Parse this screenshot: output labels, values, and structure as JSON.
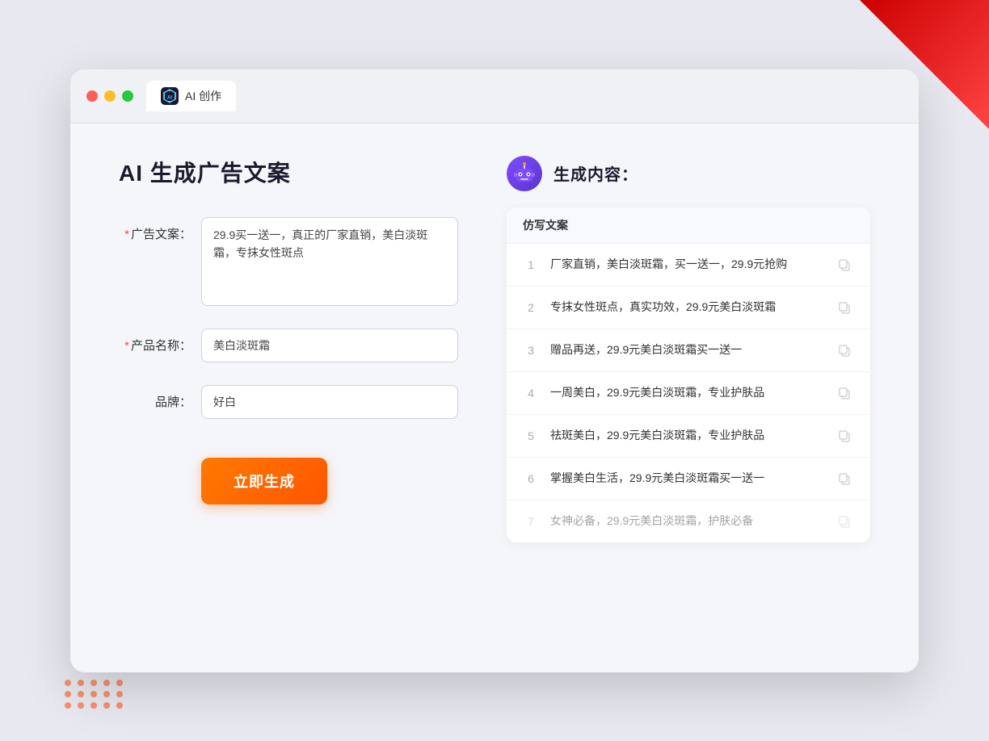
{
  "browser": {
    "tab_label": "AI 创作",
    "traffic_lights": [
      "red",
      "yellow",
      "green"
    ]
  },
  "left_panel": {
    "title": "AI 生成广告文案",
    "form": {
      "ad_copy_label": "广告文案：",
      "ad_copy_required": true,
      "ad_copy_value": "29.9买一送一，真正的厂家直销，美白淡斑霜，专抹女性斑点",
      "product_name_label": "产品名称：",
      "product_name_required": true,
      "product_name_value": "美白淡斑霜",
      "brand_label": "品牌：",
      "brand_required": false,
      "brand_value": "好白"
    },
    "generate_button": "立即生成"
  },
  "right_panel": {
    "header_title": "生成内容：",
    "table_header": "仿写文案",
    "results": [
      {
        "id": 1,
        "text": "厂家直销，美白淡斑霜，买一送一，29.9元抢购",
        "faded": false
      },
      {
        "id": 2,
        "text": "专抹女性斑点，真实功效，29.9元美白淡斑霜",
        "faded": false
      },
      {
        "id": 3,
        "text": "赠品再送，29.9元美白淡斑霜买一送一",
        "faded": false
      },
      {
        "id": 4,
        "text": "一周美白，29.9元美白淡斑霜，专业护肤品",
        "faded": false
      },
      {
        "id": 5,
        "text": "祛斑美白，29.9元美白淡斑霜，专业护肤品",
        "faded": false
      },
      {
        "id": 6,
        "text": "掌握美白生活，29.9元美白淡斑霜买一送一",
        "faded": false
      },
      {
        "id": 7,
        "text": "女神必备，29.9元美白淡斑霜，护肤必备",
        "faded": true
      }
    ]
  },
  "icons": {
    "copy": "⧉",
    "ai_label": "AI"
  }
}
